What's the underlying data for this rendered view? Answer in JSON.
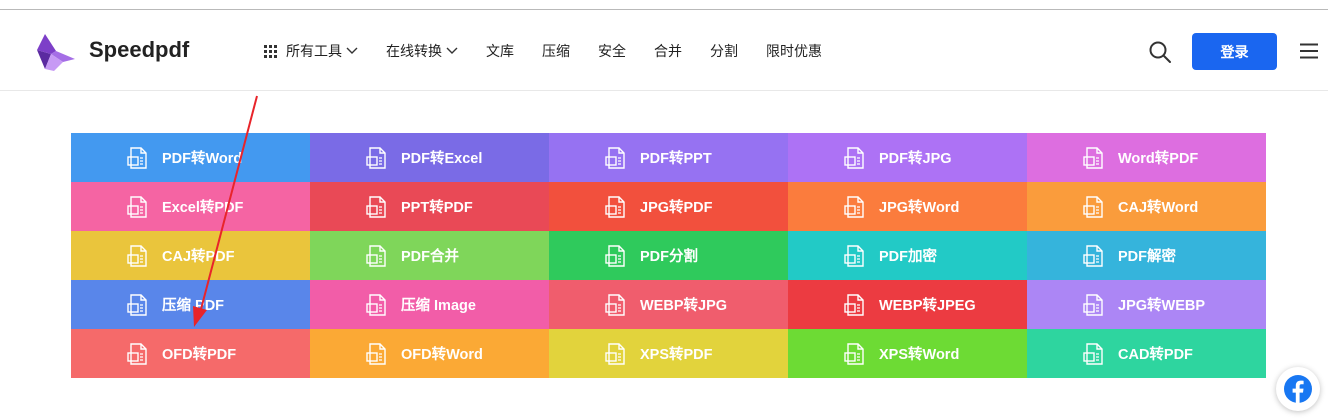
{
  "brand": {
    "name": "Speedpdf"
  },
  "nav": [
    {
      "label": "所有工具",
      "icon": "grid-icon",
      "dropdown": true
    },
    {
      "label": "在线转换",
      "dropdown": true
    },
    {
      "label": "文库"
    },
    {
      "label": "压缩"
    },
    {
      "label": "安全"
    },
    {
      "label": "合并"
    },
    {
      "label": "分割"
    },
    {
      "label": "限时优惠"
    }
  ],
  "header": {
    "login_label": "登录",
    "search_icon": "search-icon",
    "menu_icon": "hamburger-menu-icon"
  },
  "tools": [
    {
      "label": "PDF转Word",
      "color": "#4399f0"
    },
    {
      "label": "PDF转Excel",
      "color": "#7a6be6"
    },
    {
      "label": "PDF转PPT",
      "color": "#9672f2"
    },
    {
      "label": "PDF转JPG",
      "color": "#ad72f5"
    },
    {
      "label": "Word转PDF",
      "color": "#dd6ee0"
    },
    {
      "label": "Excel转PDF",
      "color": "#f564a3"
    },
    {
      "label": "PPT转PDF",
      "color": "#e94956"
    },
    {
      "label": "JPG转PDF",
      "color": "#f2503d"
    },
    {
      "label": "JPG转Word",
      "color": "#fb7c3d"
    },
    {
      "label": "CAJ转Word",
      "color": "#fa9c3c"
    },
    {
      "label": "CAJ转PDF",
      "color": "#eac53c"
    },
    {
      "label": "PDF合并",
      "color": "#7fd65a"
    },
    {
      "label": "PDF分割",
      "color": "#2fca5c"
    },
    {
      "label": "PDF加密",
      "color": "#22cac6"
    },
    {
      "label": "PDF解密",
      "color": "#35b4dc"
    },
    {
      "label": "压缩 PDF",
      "color": "#5986ea"
    },
    {
      "label": "压缩 Image",
      "color": "#f25da8"
    },
    {
      "label": "WEBP转JPG",
      "color": "#f05d6d"
    },
    {
      "label": "WEBP转JPEG",
      "color": "#ec3b41"
    },
    {
      "label": "JPG转WEBP",
      "color": "#ac86f5"
    },
    {
      "label": "OFD转PDF",
      "color": "#f56a6a"
    },
    {
      "label": "OFD转Word",
      "color": "#fba935"
    },
    {
      "label": "XPS转PDF",
      "color": "#e2d33c"
    },
    {
      "label": "XPS转Word",
      "color": "#6ddb34"
    },
    {
      "label": "CAD转PDF",
      "color": "#2ed59f"
    }
  ],
  "social": {
    "icon": "facebook-icon"
  }
}
